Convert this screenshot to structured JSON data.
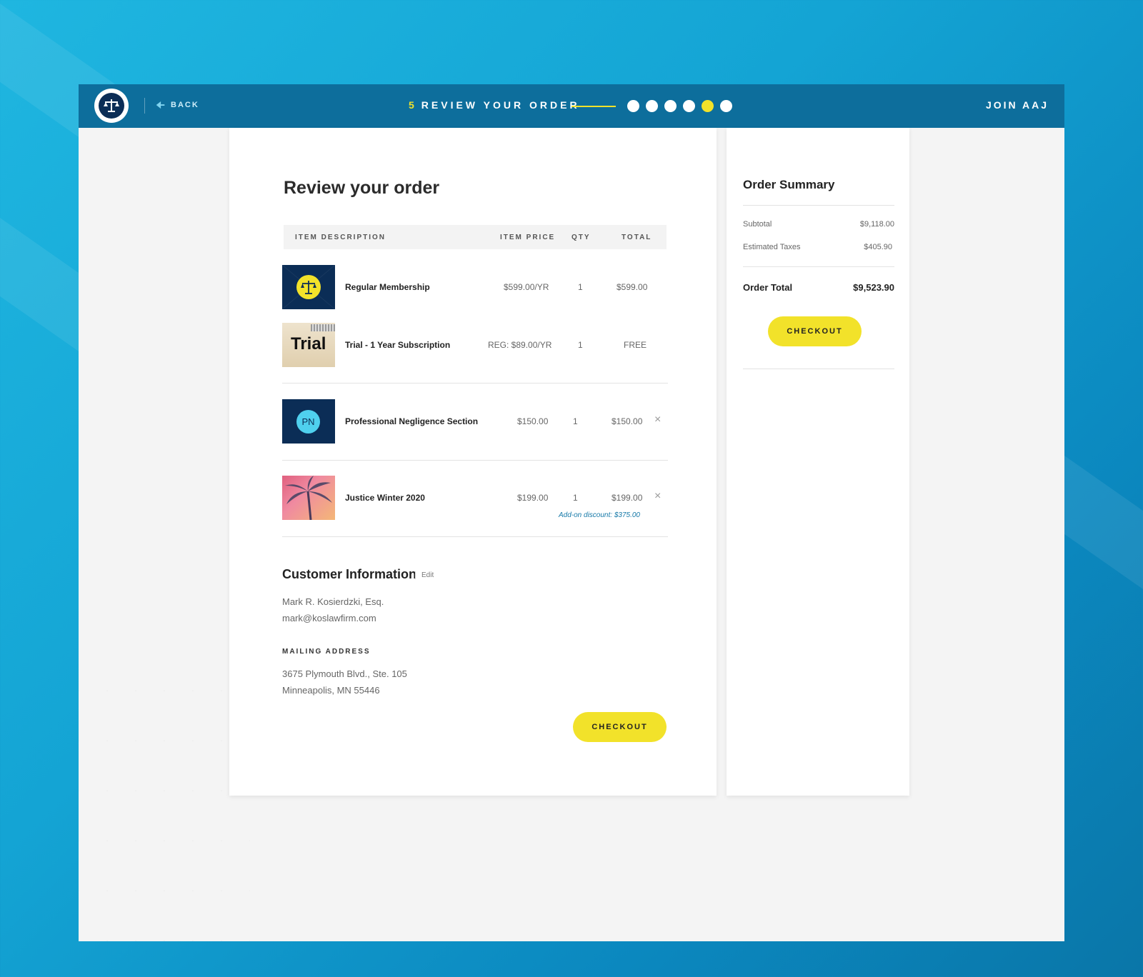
{
  "header": {
    "back_label": "BACK",
    "step_number": "5",
    "step_label": "REVIEW YOUR ORDER",
    "progress": {
      "total": 6,
      "active_index": 4
    },
    "join_label": "JOIN AAJ"
  },
  "order": {
    "title": "Review your order",
    "columns": {
      "description": "ITEM DESCRIPTION",
      "price": "ITEM PRICE",
      "qty": "QTY",
      "total": "TOTAL"
    },
    "items": [
      {
        "name": "Regular Membership",
        "price": "$599.00/YR",
        "qty": "1",
        "total": "$599.00"
      },
      {
        "name": "Trial - 1 Year Subscription",
        "price": "REG: $89.00/YR",
        "qty": "1",
        "total": "FREE",
        "thumb_text": "Trial"
      },
      {
        "name": "Professional Negligence Section",
        "price": "$150.00",
        "qty": "1",
        "total": "$150.00",
        "thumb_text": "PN",
        "remove": "×"
      },
      {
        "name": "Justice Winter 2020",
        "price": "$199.00",
        "qty": "1",
        "total": "$199.00",
        "discount": "Add-on discount: $375.00",
        "remove": "×"
      }
    ]
  },
  "customer": {
    "title": "Customer Information",
    "edit_label": "Edit",
    "name": "Mark R. Kosierdzki, Esq.",
    "email": "mark@koslawfirm.com",
    "mailing_label": "MAILING ADDRESS",
    "address_line1": "3675 Plymouth Blvd., Ste. 105",
    "address_line2": "Minneapolis, MN 55446"
  },
  "checkout_label": "CHECKOUT",
  "summary": {
    "title": "Order Summary",
    "subtotal_label": "Subtotal",
    "subtotal_value": "$9,118.00",
    "taxes_label": "Estimated Taxes",
    "taxes_value": "$405.90",
    "total_label": "Order Total",
    "total_value": "$9,523.90",
    "checkout_label": "CHECKOUT"
  },
  "colors": {
    "brand_blue": "#0d6e9c",
    "navy": "#0b2d56",
    "accent_yellow": "#f2e22a",
    "pn_cyan": "#4fd0ee"
  }
}
